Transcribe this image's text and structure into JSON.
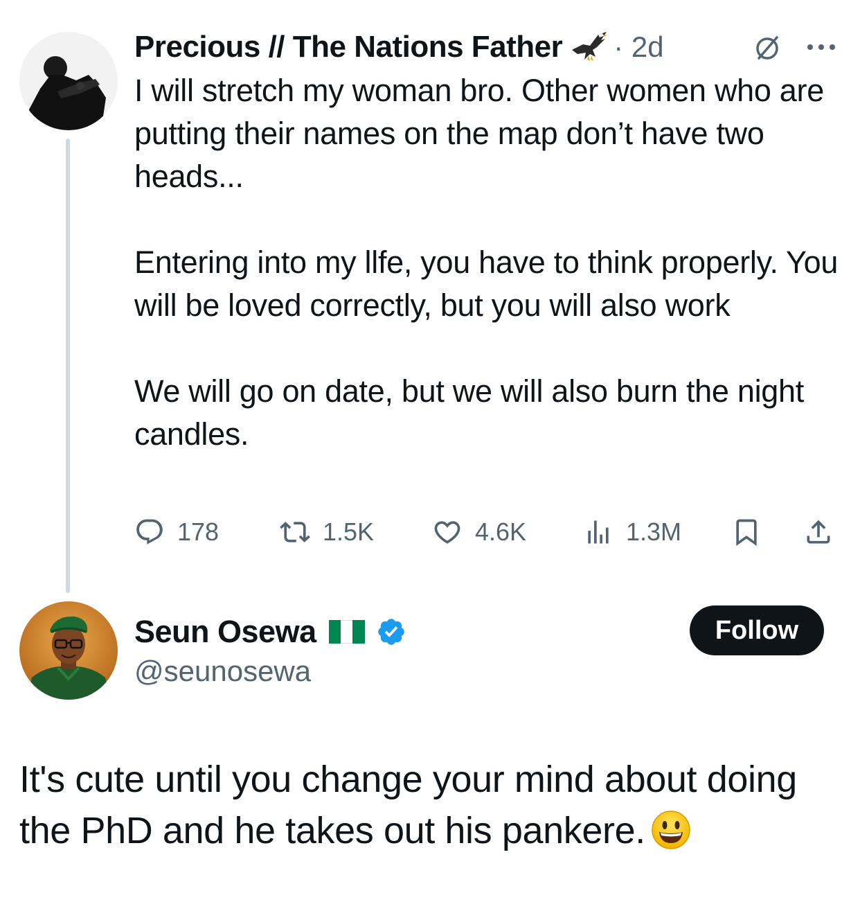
{
  "original_tweet": {
    "display_name": "Precious // The Nations Father",
    "name_emoji": "eagle-icon",
    "time_ago": "· 2d",
    "paragraphs": [
      "I will stretch my woman bro. Other women who are putting their names on the map don’t have two heads...",
      "Entering into my llfe, you have to think properly. You will be loved correctly, but you will also work",
      "We will go on date, but we will also burn the night candles."
    ],
    "stats": {
      "replies": "178",
      "reposts": "1.5K",
      "likes": "4.6K",
      "views": "1.3M"
    }
  },
  "reply_tweet": {
    "display_name": "Seun Osewa",
    "flag": "nigeria-flag",
    "handle": "@seunosewa",
    "follow_label": "Follow",
    "text": "It's cute until you change your mind about doing the PhD and he takes out his pankere.",
    "emoji": "smiley-emoji"
  },
  "colors": {
    "text": "#0f1419",
    "secondary": "#536471",
    "thread_line": "#cfd9de",
    "verified_blue": "#1d9bf0",
    "follow_bg": "#0f1419",
    "nigeria_green": "#008751"
  }
}
